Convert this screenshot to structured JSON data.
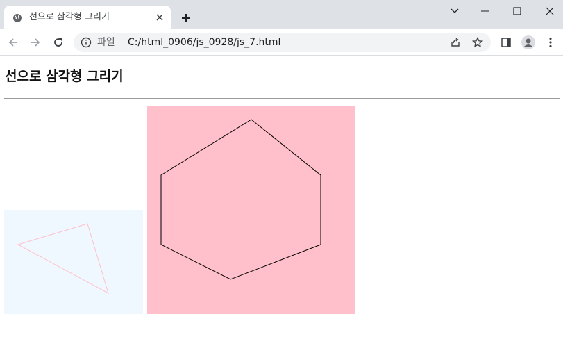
{
  "browser": {
    "tab": {
      "title": "선으로 삼각형 그리기"
    },
    "address": {
      "scheme_label": "파일",
      "url": "C:/html_0906/js_0928/js_7.html"
    }
  },
  "page": {
    "heading": "선으로 삼각형 그리기"
  },
  "canvases": {
    "triangle": {
      "background": "#f0f8ff",
      "stroke": "#ffc0cb"
    },
    "hexagon": {
      "background": "#ffc0cb",
      "stroke": "#000000"
    }
  }
}
